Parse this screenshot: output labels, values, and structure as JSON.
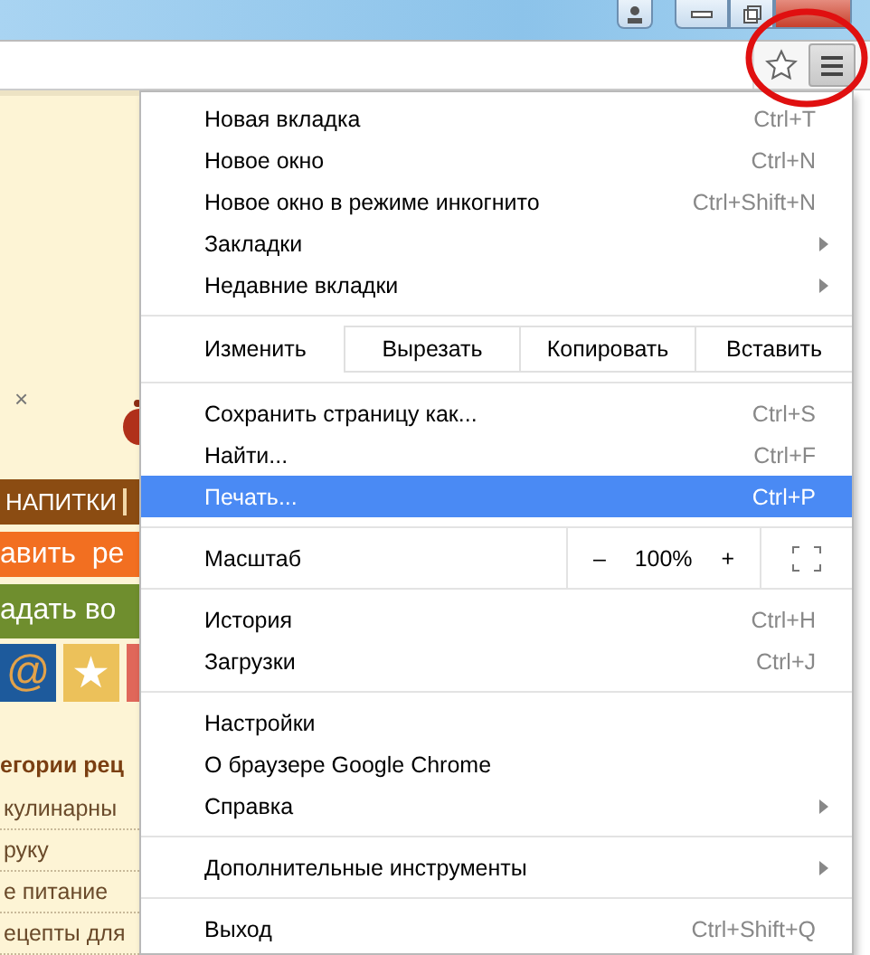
{
  "site": {
    "close_mark": "×",
    "nav_tab": "НАПИТКИ",
    "add_button": "авить  ре",
    "ask_button": "адать во",
    "social_tiles": [
      {
        "kind": "mail",
        "glyph": "@",
        "color": "#1d5a9c"
      },
      {
        "kind": "star",
        "glyph": "★",
        "color": "#ecc15a"
      },
      {
        "kind": "blank",
        "color": "#e0675a"
      }
    ],
    "categories_heading": "егории рец",
    "category_links": [
      "кулинарны",
      "руку",
      "е питание",
      "ецепты для"
    ]
  },
  "menu": {
    "items": [
      {
        "kind": "item",
        "label": "Новая вкладка",
        "shortcut": "Ctrl+T",
        "submenu": false,
        "selected": false
      },
      {
        "kind": "item",
        "label": "Новое окно",
        "shortcut": "Ctrl+N",
        "submenu": false,
        "selected": false
      },
      {
        "kind": "item",
        "label": "Новое окно в режиме инкогнито",
        "shortcut": "Ctrl+Shift+N",
        "submenu": false,
        "selected": false
      },
      {
        "kind": "item",
        "label": "Закладки",
        "submenu": true,
        "selected": false
      },
      {
        "kind": "item",
        "label": "Недавние вкладки",
        "submenu": true,
        "selected": false
      },
      {
        "kind": "separator"
      },
      {
        "kind": "edit",
        "label": "Изменить",
        "actions": [
          "Вырезать",
          "Копировать",
          "Вставить"
        ]
      },
      {
        "kind": "separator"
      },
      {
        "kind": "item",
        "label": "Сохранить страницу как...",
        "shortcut": "Ctrl+S",
        "submenu": false,
        "selected": false
      },
      {
        "kind": "item",
        "label": "Найти...",
        "shortcut": "Ctrl+F",
        "submenu": false,
        "selected": false
      },
      {
        "kind": "item",
        "label": "Печать...",
        "shortcut": "Ctrl+P",
        "submenu": false,
        "selected": true
      },
      {
        "kind": "separator"
      },
      {
        "kind": "zoom",
        "label": "Масштаб",
        "minus": "–",
        "value": "100%",
        "plus": "+"
      },
      {
        "kind": "separator"
      },
      {
        "kind": "item",
        "label": "История",
        "shortcut": "Ctrl+H",
        "submenu": false,
        "selected": false
      },
      {
        "kind": "item",
        "label": "Загрузки",
        "shortcut": "Ctrl+J",
        "submenu": false,
        "selected": false
      },
      {
        "kind": "separator"
      },
      {
        "kind": "item",
        "label": "Настройки",
        "submenu": false,
        "selected": false
      },
      {
        "kind": "item",
        "label": "О браузере Google Chrome",
        "submenu": false,
        "selected": false
      },
      {
        "kind": "item",
        "label": "Справка",
        "submenu": true,
        "selected": false
      },
      {
        "kind": "separator"
      },
      {
        "kind": "item",
        "label": "Дополнительные инструменты",
        "submenu": true,
        "selected": false
      },
      {
        "kind": "separator"
      },
      {
        "kind": "item",
        "label": "Выход",
        "shortcut": "Ctrl+Shift+Q",
        "submenu": false,
        "selected": false
      }
    ]
  }
}
